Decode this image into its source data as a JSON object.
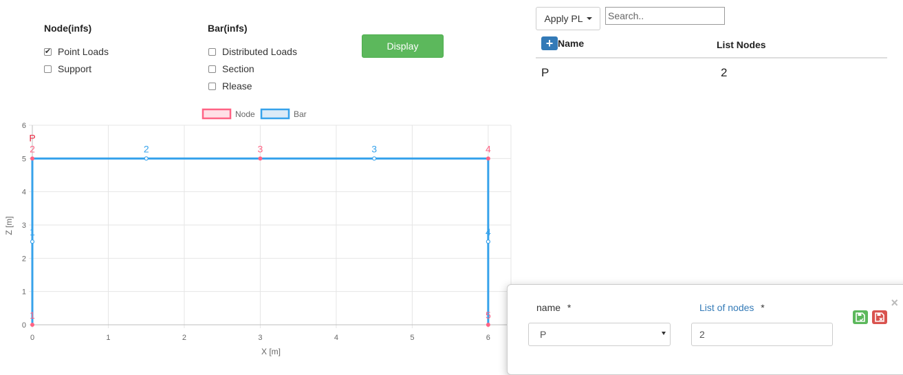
{
  "node_group": {
    "title": "Node(infs)",
    "options": [
      {
        "label": "Point Loads",
        "checked": true
      },
      {
        "label": "Support",
        "checked": false
      }
    ]
  },
  "bar_group": {
    "title": "Bar(infs)",
    "options": [
      {
        "label": "Distributed Loads",
        "checked": false
      },
      {
        "label": "Section",
        "checked": false
      },
      {
        "label": "Rlease",
        "checked": false
      }
    ]
  },
  "display_button": "Display",
  "toolbar": {
    "apply_label": "Apply PL",
    "search_placeholder": "Search.."
  },
  "table": {
    "headers": [
      "Name",
      "List Nodes"
    ],
    "rows": [
      {
        "name": "P",
        "list_nodes": "2"
      }
    ]
  },
  "modal": {
    "name_label": "name",
    "nodes_label": "List of nodes",
    "required_mark": "*",
    "name_value": "P",
    "nodes_value": "2",
    "close_symbol": "×",
    "save_icon": "save-icon",
    "cancel_icon": "cancel-icon"
  },
  "colors": {
    "node": "#ff6384",
    "bar": "#36a2eb",
    "display_button": "#5cb85c",
    "add_button": "#337ab7",
    "save_button": "#5cb85c",
    "cancel_button": "#d9534f",
    "modal_link": "#337ab7"
  },
  "chart_data": {
    "type": "scatter",
    "xlabel": "X [m]",
    "ylabel": "Z [m]",
    "xlim": [
      0,
      6.3
    ],
    "ylim": [
      0,
      6
    ],
    "x_ticks": [
      0,
      1,
      2,
      3,
      4,
      5,
      6
    ],
    "y_ticks": [
      0,
      1,
      2,
      3,
      4,
      5,
      6
    ],
    "grid": true,
    "legend": [
      "Node",
      "Bar"
    ],
    "legend_placement": "top-center",
    "nodes": [
      {
        "id": "1",
        "x": 0,
        "y": 0
      },
      {
        "id": "2",
        "x": 0,
        "y": 5
      },
      {
        "id": "3",
        "x": 3,
        "y": 5
      },
      {
        "id": "4",
        "x": 6,
        "y": 5
      },
      {
        "id": "5",
        "x": 6,
        "y": 0
      }
    ],
    "bars": [
      {
        "id": "1",
        "from": [
          0,
          0
        ],
        "to": [
          0,
          5
        ],
        "mid": [
          0,
          2.5
        ]
      },
      {
        "id": "2",
        "from": [
          0,
          5
        ],
        "to": [
          3,
          5
        ],
        "mid": [
          1.5,
          5
        ]
      },
      {
        "id": "3",
        "from": [
          3,
          5
        ],
        "to": [
          6,
          5
        ],
        "mid": [
          4.5,
          5
        ]
      },
      {
        "id": "4",
        "from": [
          6,
          5
        ],
        "to": [
          6,
          0
        ],
        "mid": [
          6,
          2.5
        ]
      }
    ],
    "loads": [
      {
        "label": "P",
        "node": "2",
        "x": 0,
        "y": 5
      }
    ]
  }
}
